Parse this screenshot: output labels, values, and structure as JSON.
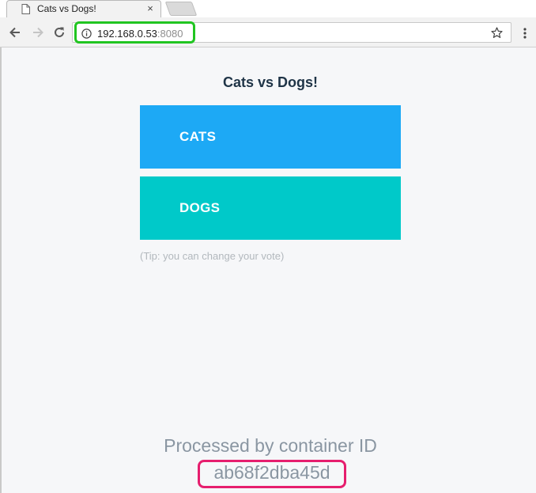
{
  "browser": {
    "tab_title": "Cats vs Dogs!",
    "tab_close": "×",
    "url_host": "192.168.0.53",
    "url_port": ":8080",
    "highlight_color": "#21c521"
  },
  "page": {
    "title": "Cats vs Dogs!",
    "options": [
      {
        "label": "CATS",
        "color": "#1da9f5"
      },
      {
        "label": "DOGS",
        "color": "#00c9c9"
      }
    ],
    "tip": "(Tip: you can change your vote)",
    "processed_label": "Processed by container ID",
    "container_id": "ab68f2dba45d",
    "container_highlight_color": "#e61e6e"
  }
}
